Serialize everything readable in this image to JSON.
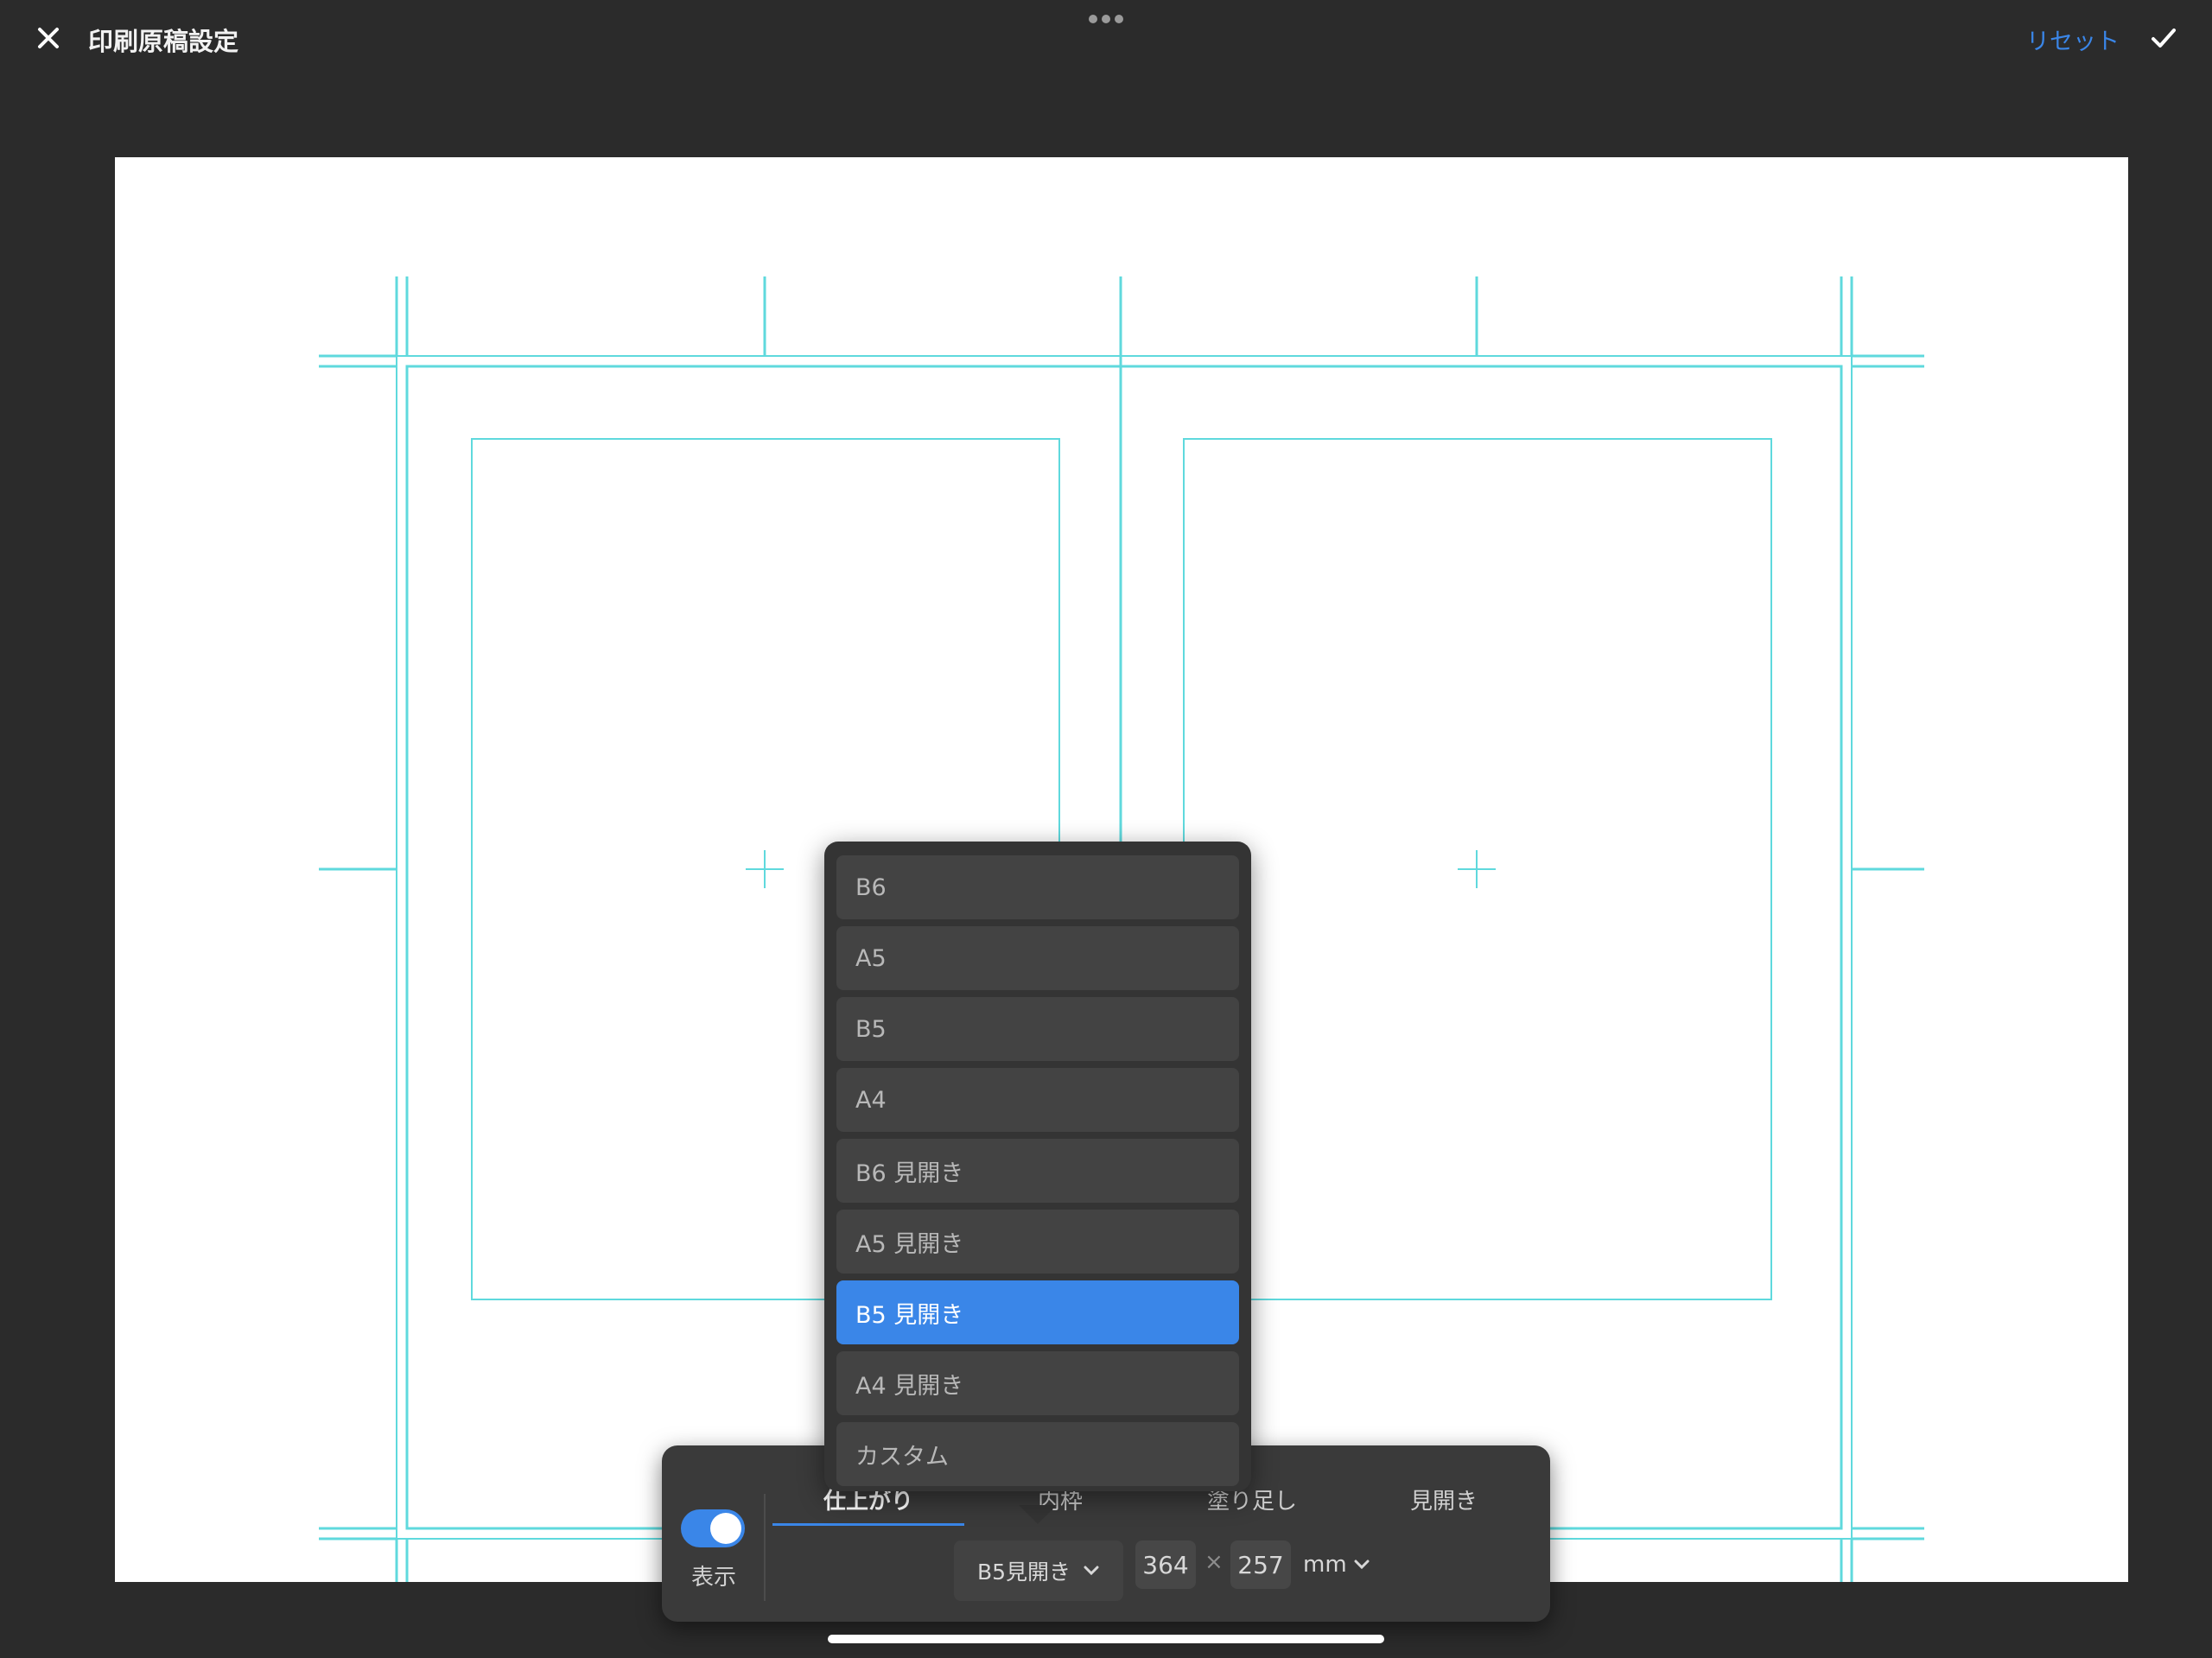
{
  "topbar": {
    "title": "印刷原稿設定",
    "reset_label": "リセット",
    "close_icon": "close-icon",
    "confirm_icon": "checkmark-icon",
    "more_icon": "more-dots-icon"
  },
  "size_menu": {
    "items": [
      "B6",
      "A5",
      "B5",
      "A4",
      "B6 見開き",
      "A5 見開き",
      "B5 見開き",
      "A4 見開き",
      "カスタム"
    ],
    "selected": "B5 見開き"
  },
  "panel": {
    "toggle_label": "表示",
    "toggle_on": true,
    "tabs": [
      "仕上がり",
      "内枠",
      "塗り足し",
      "見開き"
    ],
    "active_tab": "仕上がり",
    "size_select_value": "B5見開き",
    "width_value": "364",
    "times_sign": "×",
    "height_value": "257",
    "unit": "mm"
  },
  "colors": {
    "accent": "#3a86e8",
    "guide_line": "#5fd9dd",
    "background": "#2b2b2b",
    "canvas": "#ffffff"
  }
}
